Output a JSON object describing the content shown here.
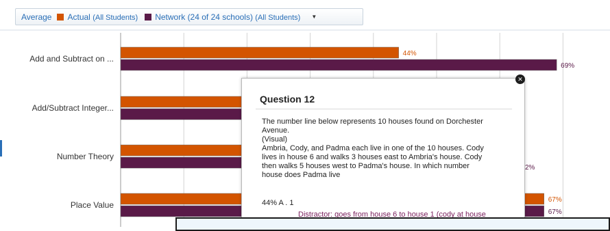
{
  "legend": {
    "average": "Average",
    "actual": "Actual",
    "actual_sub": "(All Students)",
    "network": "Network (24 of 24 schools)",
    "network_sub": "(All Students)"
  },
  "chart_data": {
    "type": "bar",
    "orientation": "horizontal",
    "categories": [
      "Add and Subtract on ...",
      "Add/Subtract Integer...",
      "Number Theory",
      "Place Value"
    ],
    "series": [
      {
        "name": "Actual (All Students)",
        "color": "#d35400",
        "values": [
          44,
          null,
          null,
          67
        ]
      },
      {
        "name": "Network (24 of 24 schools) (All Students)",
        "color": "#5a1a48",
        "values": [
          69,
          null,
          null,
          67
        ]
      }
    ],
    "xlim": [
      0,
      100
    ],
    "grid": true,
    "partial_labels": [
      "2%"
    ]
  },
  "tooltip": {
    "title": "Question 12",
    "lines": [
      "The number line below represents 10 houses found on Dorchester",
      "Avenue.",
      "(Visual)",
      "Ambria, Cody, and Padma each live in one of the 10 houses. Cody",
      "lives in house 6 and walks 3 houses east to Ambria's house. Cody",
      "then walks 5 houses west to Padma's house. In which number",
      "house does Padma live"
    ],
    "answer": "44%   A . 1",
    "distractor": "Distractor: goes from house 6 to house 1 (cody at house"
  }
}
